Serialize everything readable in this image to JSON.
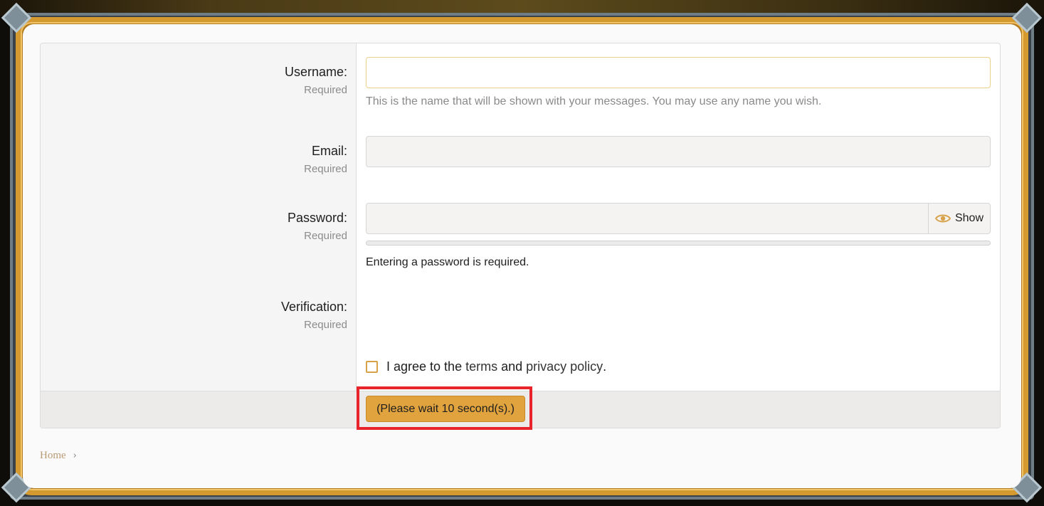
{
  "form": {
    "username": {
      "label": "Username:",
      "required": "Required",
      "value": "",
      "hint": "This is the name that will be shown with your messages. You may use any name you wish."
    },
    "email": {
      "label": "Email:",
      "required": "Required",
      "value": ""
    },
    "password": {
      "label": "Password:",
      "required": "Required",
      "value": "",
      "show_label": "Show",
      "show_icon": "eye-icon",
      "hint": "Entering a password is required.",
      "strength": 0
    },
    "verification": {
      "label": "Verification:",
      "required": "Required"
    },
    "agree": {
      "text_before": "I agree to the",
      "terms_link": "terms",
      "and": "and",
      "privacy_link": "privacy policy",
      "text_after": ".",
      "checked": false
    },
    "submit_label": "(Please wait 10 second(s).)"
  },
  "breadcrumb": {
    "home": "Home",
    "separator_icon": "chevron-right-icon"
  },
  "colors": {
    "accent": "#e0a33e",
    "frame_gold": "#d59a2f",
    "highlight": "#e8232b",
    "link": "#b99a74"
  }
}
